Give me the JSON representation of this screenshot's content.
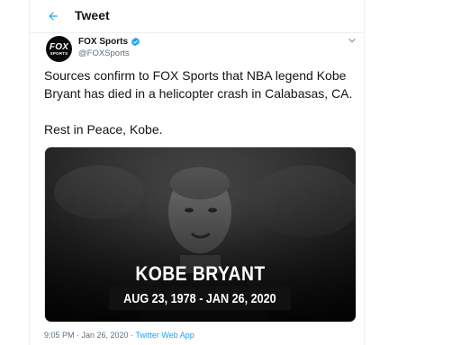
{
  "header": {
    "title": "Tweet",
    "back_icon": "back-arrow-icon"
  },
  "tweet": {
    "avatar": {
      "line1": "FOX",
      "line2": "SPORTS"
    },
    "display_name": "FOX Sports",
    "verified_icon": "verified-badge-icon",
    "handle": "@FOXSports",
    "text_line1": "Sources confirm to FOX Sports that NBA legend Kobe Bryant has died in a helicopter crash in Calabasas, CA.",
    "text_line2": "Rest in Peace, Kobe.",
    "media": {
      "name": "KOBE BRYANT",
      "dates": "AUG 23, 1978 - JAN 26, 2020"
    },
    "time": "9:05 PM · Jan 26, 2020",
    "separator": " · ",
    "source_app": "Twitter Web App"
  },
  "colors": {
    "accent": "#1da1f2",
    "secondary_text": "#5b7083",
    "border": "#ebeef0"
  }
}
